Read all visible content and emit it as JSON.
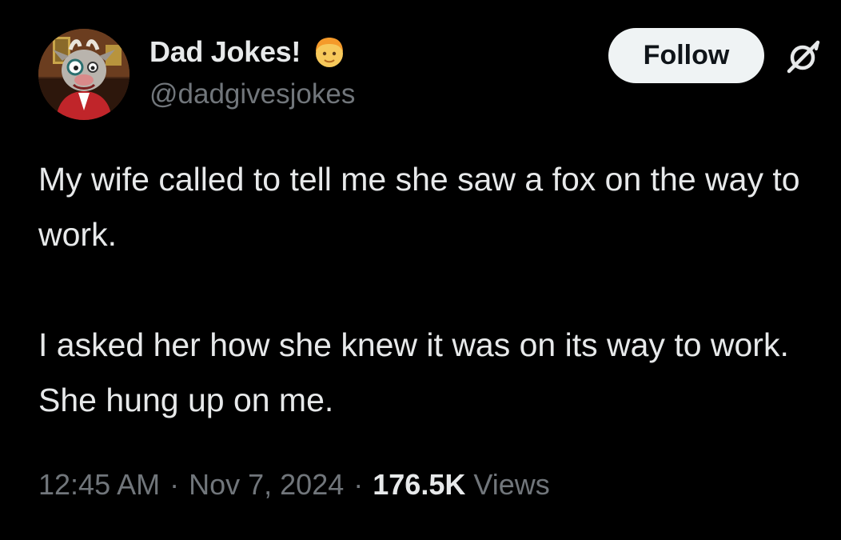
{
  "author": {
    "name": "Dad Jokes!",
    "handle": "@dadgivesjokes",
    "badge_icon": "man-face-emoji"
  },
  "actions": {
    "follow_label": "Follow",
    "grok_icon": "grok-icon"
  },
  "tweet": {
    "paragraphs": [
      "My wife called to tell me she saw a fox on the way to work.",
      "I asked her how she knew it was on its way to work. She hung up on me."
    ]
  },
  "meta": {
    "time": "12:45 AM",
    "separator": "·",
    "date": "Nov 7, 2024",
    "views_count": "176.5K",
    "views_label": "Views"
  },
  "colors": {
    "background": "#000000",
    "primary_text": "#e7e9ea",
    "secondary_text": "#71767b",
    "follow_bg": "#eff3f4",
    "follow_text": "#0f1419"
  }
}
